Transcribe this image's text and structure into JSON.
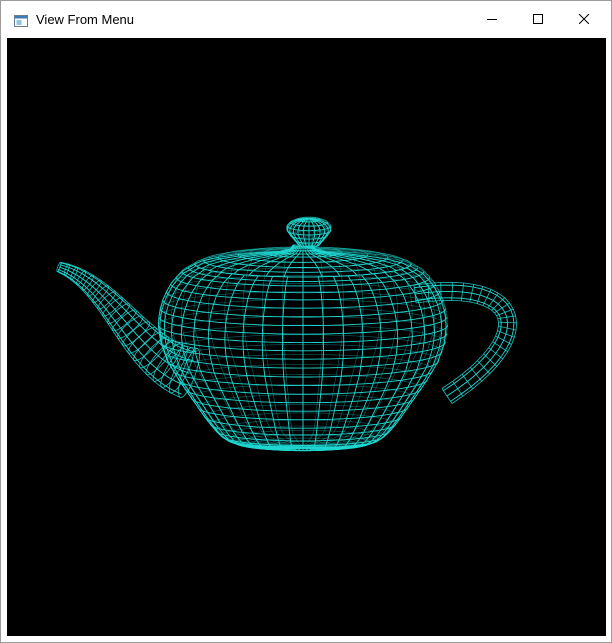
{
  "window": {
    "title": "View From Menu",
    "icon": "app-window-icon",
    "controls": {
      "minimize_icon": "minimize-icon",
      "maximize_icon": "maximize-icon",
      "close_icon": "close-icon"
    }
  },
  "canvas": {
    "background_color": "#000000",
    "model": "teapot",
    "render_mode": "wireframe",
    "wire_color": "#1fd6d0"
  }
}
